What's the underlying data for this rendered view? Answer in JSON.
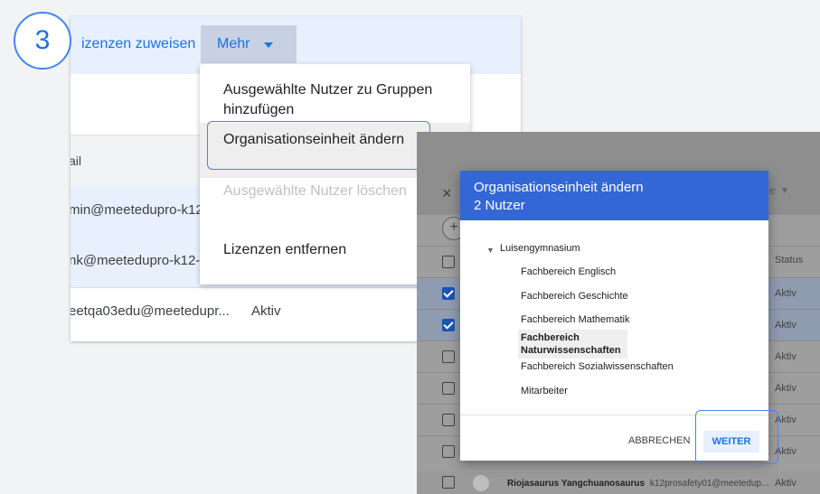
{
  "step": {
    "number": "3"
  },
  "toolbar": {
    "assign_link": "izenzen zuweisen",
    "more_label": "Mehr"
  },
  "table": {
    "email_header": "ail",
    "rows": [
      {
        "email": "min@meetedupro-k12",
        "status": "",
        "selected": true
      },
      {
        "email": "nk@meetedupro-k12-",
        "status": "",
        "selected": true
      },
      {
        "email": "eetqa03edu@meetedupr...",
        "status": "Aktiv",
        "selected": false
      }
    ]
  },
  "menu": {
    "items": [
      {
        "label": "Ausgewählte Nutzer zu Gruppen hinzufügen",
        "state": "normal"
      },
      {
        "label": "Organisationseinheit ändern",
        "state": "highlighted"
      },
      {
        "label": "Ausgewählte Nutzer löschen",
        "state": "disabled"
      },
      {
        "label": "Lizenzen entfernen",
        "state": "normal"
      }
    ]
  },
  "right_panel": {
    "close_icon": "×",
    "mehr_fragment": "e",
    "plus_icon": "+",
    "status_header": "Status",
    "rows": [
      {
        "checked": false,
        "status": ""
      },
      {
        "checked": true,
        "status": "Aktiv"
      },
      {
        "checked": true,
        "status": "Aktiv"
      },
      {
        "checked": false,
        "status": "Aktiv"
      },
      {
        "checked": false,
        "status": "Aktiv"
      },
      {
        "checked": false,
        "status": "Aktiv"
      },
      {
        "checked": false,
        "status": "Aktiv"
      }
    ],
    "bottom_row": {
      "name": "Riojasaurus Yangchuanosaurus",
      "email": "k12prosafety01@meetedup...",
      "status": "Aktiv"
    }
  },
  "dialog": {
    "title": "Organisationseinheit ändern",
    "subtitle": "2 Nutzer",
    "tree": {
      "root": "Luisengymnasium",
      "children": [
        "Fachbereich Englisch",
        "Fachbereich Geschichte",
        "Fachbereich Mathematik",
        "Fachbereich Naturwissenschaften",
        "Fachbereich Sozialwissenschaften",
        "Mitarbeiter"
      ],
      "selected_index": 3
    },
    "cancel_label": "ABBRECHEN",
    "next_label": "WEITER"
  },
  "colors": {
    "accent": "#1a73e8",
    "dialog_header": "#3367d6",
    "highlight_outline": "#4285f4",
    "selected_row": "#e8f0fe"
  }
}
